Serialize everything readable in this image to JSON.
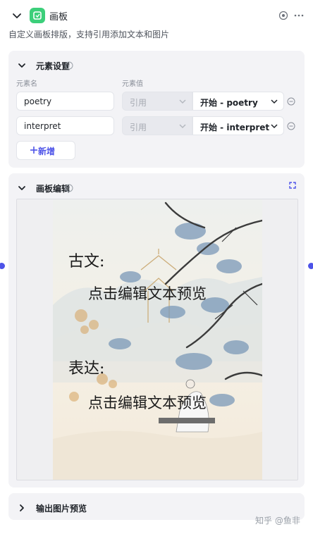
{
  "node": {
    "title": "画板",
    "description": "自定义画板排版，支持引用添加文本和图片"
  },
  "element_settings": {
    "title": "元素设置",
    "col_name": "元素名",
    "col_value": "元素值",
    "rows": [
      {
        "name": "poetry",
        "ref_type": "引用",
        "source": "开始 - poetry"
      },
      {
        "name": "interpret",
        "ref_type": "引用",
        "source": "开始 - interpret"
      }
    ],
    "add_label": "新增"
  },
  "canvas_edit": {
    "title": "画板编辑",
    "label1": "古文:",
    "body1": "点击编辑文本预览",
    "label2": "表达:",
    "body2": "点击编辑文本预览"
  },
  "output_preview": {
    "title": "输出图片预览"
  },
  "watermark": "知乎 @鱼非",
  "colors": {
    "accent": "#4d53e8",
    "app_icon": "#3ccf7a",
    "panel_bg": "#f3f3f6"
  }
}
